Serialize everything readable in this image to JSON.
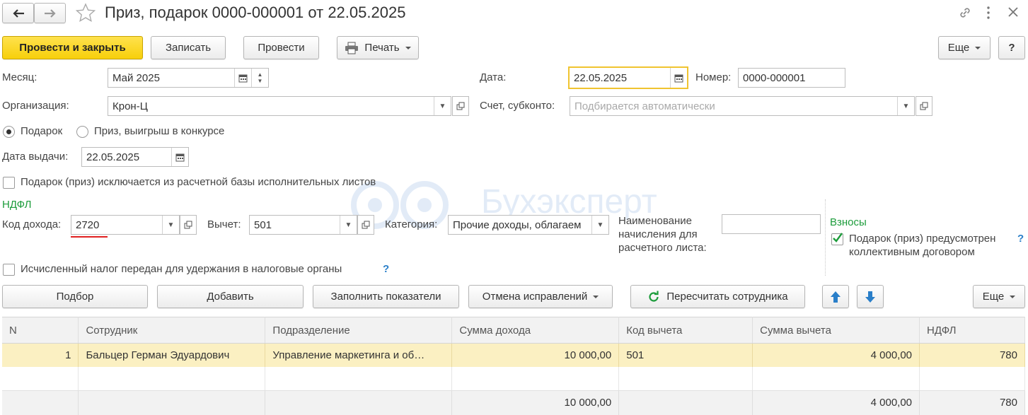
{
  "window": {
    "title": "Приз, подарок 0000-000001 от 22.05.2025"
  },
  "toolbar": {
    "post_close": "Провести и закрыть",
    "save": "Записать",
    "post": "Провести",
    "print": "Печать",
    "more": "Еще",
    "help": "?"
  },
  "form": {
    "month_label": "Месяц:",
    "month_value": "Май 2025",
    "date_label": "Дата:",
    "date_value": "22.05.2025",
    "number_label": "Номер:",
    "number_value": "0000-000001",
    "org_label": "Организация:",
    "org_value": "Крон-Ц",
    "account_label": "Счет, субконто:",
    "account_placeholder": "Подбирается автоматически",
    "radio_gift": "Подарок",
    "radio_prize": "Приз, выигрыш в конкурсе",
    "issue_date_label": "Дата выдачи:",
    "issue_date_value": "22.05.2025",
    "excluded_label": "Подарок (приз) исключается из расчетной базы исполнительных листов",
    "excluded_checked": false
  },
  "ndfl": {
    "section": "НДФЛ",
    "income_code_label": "Код дохода:",
    "income_code_value": "2720",
    "deduction_label": "Вычет:",
    "deduction_value": "501",
    "category_label": "Категория:",
    "category_value": "Прочие доходы, облагаем",
    "payslip_name_label_1": "Наименование",
    "payslip_name_label_2": "начисления для",
    "payslip_name_label_3": "расчетного листа:",
    "payslip_name_value": "",
    "tax_transferred_label": "Исчисленный налог передан для удержания в налоговые органы",
    "tax_transferred_checked": false,
    "help": "?"
  },
  "contributions": {
    "section": "Взносы",
    "collective_label_1": "Подарок (приз) предусмотрен",
    "collective_label_2": "коллективным договором",
    "collective_checked": true,
    "help": "?"
  },
  "table_toolbar": {
    "pick": "Подбор",
    "add": "Добавить",
    "fill": "Заполнить показатели",
    "cancel_fix": "Отмена исправлений",
    "recalc": "Пересчитать сотрудника",
    "more": "Еще"
  },
  "table": {
    "headers": [
      "N",
      "Сотрудник",
      "Подразделение",
      "Сумма дохода",
      "Код вычета",
      "Сумма вычета",
      "НДФЛ"
    ],
    "rows": [
      [
        "1",
        "Бальцер Герман Эдуардович",
        "Управление маркетинга и об…",
        "10 000,00",
        "501",
        "4 000,00",
        "780"
      ]
    ],
    "totals": [
      "",
      "",
      "",
      "10 000,00",
      "",
      "4 000,00",
      "780"
    ]
  },
  "watermark": "Бухэксперт",
  "colors": {
    "primary_button": "#f7cf0b",
    "green_section": "#1c9c3b",
    "focus_border": "#f0c430",
    "selected_row": "#fbf0c2",
    "underline_red": "#e02020"
  }
}
